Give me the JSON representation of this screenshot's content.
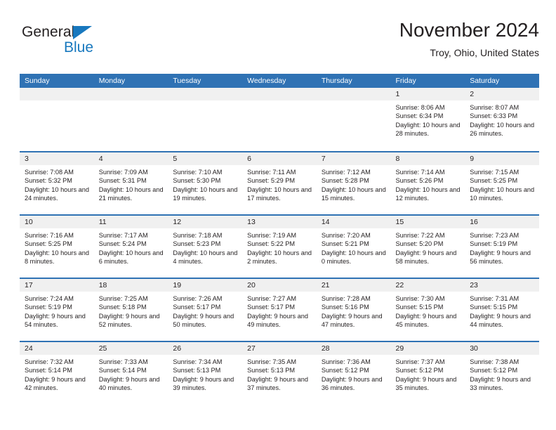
{
  "brand": {
    "name_part1": "General",
    "name_part2": "Blue"
  },
  "header": {
    "title": "November 2024",
    "subtitle": "Troy, Ohio, United States"
  },
  "colors": {
    "header_blue": "#2f72b4",
    "brand_blue": "#1878be",
    "daynum_band": "#f0f0f0",
    "text": "#231f20"
  },
  "calendar": {
    "weekday_headers": [
      "Sunday",
      "Monday",
      "Tuesday",
      "Wednesday",
      "Thursday",
      "Friday",
      "Saturday"
    ],
    "weeks": [
      [
        {
          "day": "",
          "sunrise": "",
          "sunset": "",
          "daylight": "",
          "empty": true
        },
        {
          "day": "",
          "sunrise": "",
          "sunset": "",
          "daylight": "",
          "empty": true
        },
        {
          "day": "",
          "sunrise": "",
          "sunset": "",
          "daylight": "",
          "empty": true
        },
        {
          "day": "",
          "sunrise": "",
          "sunset": "",
          "daylight": "",
          "empty": true
        },
        {
          "day": "",
          "sunrise": "",
          "sunset": "",
          "daylight": "",
          "empty": true
        },
        {
          "day": "1",
          "sunrise": "Sunrise: 8:06 AM",
          "sunset": "Sunset: 6:34 PM",
          "daylight": "Daylight: 10 hours and 28 minutes.",
          "empty": false
        },
        {
          "day": "2",
          "sunrise": "Sunrise: 8:07 AM",
          "sunset": "Sunset: 6:33 PM",
          "daylight": "Daylight: 10 hours and 26 minutes.",
          "empty": false
        }
      ],
      [
        {
          "day": "3",
          "sunrise": "Sunrise: 7:08 AM",
          "sunset": "Sunset: 5:32 PM",
          "daylight": "Daylight: 10 hours and 24 minutes.",
          "empty": false
        },
        {
          "day": "4",
          "sunrise": "Sunrise: 7:09 AM",
          "sunset": "Sunset: 5:31 PM",
          "daylight": "Daylight: 10 hours and 21 minutes.",
          "empty": false
        },
        {
          "day": "5",
          "sunrise": "Sunrise: 7:10 AM",
          "sunset": "Sunset: 5:30 PM",
          "daylight": "Daylight: 10 hours and 19 minutes.",
          "empty": false
        },
        {
          "day": "6",
          "sunrise": "Sunrise: 7:11 AM",
          "sunset": "Sunset: 5:29 PM",
          "daylight": "Daylight: 10 hours and 17 minutes.",
          "empty": false
        },
        {
          "day": "7",
          "sunrise": "Sunrise: 7:12 AM",
          "sunset": "Sunset: 5:28 PM",
          "daylight": "Daylight: 10 hours and 15 minutes.",
          "empty": false
        },
        {
          "day": "8",
          "sunrise": "Sunrise: 7:14 AM",
          "sunset": "Sunset: 5:26 PM",
          "daylight": "Daylight: 10 hours and 12 minutes.",
          "empty": false
        },
        {
          "day": "9",
          "sunrise": "Sunrise: 7:15 AM",
          "sunset": "Sunset: 5:25 PM",
          "daylight": "Daylight: 10 hours and 10 minutes.",
          "empty": false
        }
      ],
      [
        {
          "day": "10",
          "sunrise": "Sunrise: 7:16 AM",
          "sunset": "Sunset: 5:25 PM",
          "daylight": "Daylight: 10 hours and 8 minutes.",
          "empty": false
        },
        {
          "day": "11",
          "sunrise": "Sunrise: 7:17 AM",
          "sunset": "Sunset: 5:24 PM",
          "daylight": "Daylight: 10 hours and 6 minutes.",
          "empty": false
        },
        {
          "day": "12",
          "sunrise": "Sunrise: 7:18 AM",
          "sunset": "Sunset: 5:23 PM",
          "daylight": "Daylight: 10 hours and 4 minutes.",
          "empty": false
        },
        {
          "day": "13",
          "sunrise": "Sunrise: 7:19 AM",
          "sunset": "Sunset: 5:22 PM",
          "daylight": "Daylight: 10 hours and 2 minutes.",
          "empty": false
        },
        {
          "day": "14",
          "sunrise": "Sunrise: 7:20 AM",
          "sunset": "Sunset: 5:21 PM",
          "daylight": "Daylight: 10 hours and 0 minutes.",
          "empty": false
        },
        {
          "day": "15",
          "sunrise": "Sunrise: 7:22 AM",
          "sunset": "Sunset: 5:20 PM",
          "daylight": "Daylight: 9 hours and 58 minutes.",
          "empty": false
        },
        {
          "day": "16",
          "sunrise": "Sunrise: 7:23 AM",
          "sunset": "Sunset: 5:19 PM",
          "daylight": "Daylight: 9 hours and 56 minutes.",
          "empty": false
        }
      ],
      [
        {
          "day": "17",
          "sunrise": "Sunrise: 7:24 AM",
          "sunset": "Sunset: 5:19 PM",
          "daylight": "Daylight: 9 hours and 54 minutes.",
          "empty": false
        },
        {
          "day": "18",
          "sunrise": "Sunrise: 7:25 AM",
          "sunset": "Sunset: 5:18 PM",
          "daylight": "Daylight: 9 hours and 52 minutes.",
          "empty": false
        },
        {
          "day": "19",
          "sunrise": "Sunrise: 7:26 AM",
          "sunset": "Sunset: 5:17 PM",
          "daylight": "Daylight: 9 hours and 50 minutes.",
          "empty": false
        },
        {
          "day": "20",
          "sunrise": "Sunrise: 7:27 AM",
          "sunset": "Sunset: 5:17 PM",
          "daylight": "Daylight: 9 hours and 49 minutes.",
          "empty": false
        },
        {
          "day": "21",
          "sunrise": "Sunrise: 7:28 AM",
          "sunset": "Sunset: 5:16 PM",
          "daylight": "Daylight: 9 hours and 47 minutes.",
          "empty": false
        },
        {
          "day": "22",
          "sunrise": "Sunrise: 7:30 AM",
          "sunset": "Sunset: 5:15 PM",
          "daylight": "Daylight: 9 hours and 45 minutes.",
          "empty": false
        },
        {
          "day": "23",
          "sunrise": "Sunrise: 7:31 AM",
          "sunset": "Sunset: 5:15 PM",
          "daylight": "Daylight: 9 hours and 44 minutes.",
          "empty": false
        }
      ],
      [
        {
          "day": "24",
          "sunrise": "Sunrise: 7:32 AM",
          "sunset": "Sunset: 5:14 PM",
          "daylight": "Daylight: 9 hours and 42 minutes.",
          "empty": false
        },
        {
          "day": "25",
          "sunrise": "Sunrise: 7:33 AM",
          "sunset": "Sunset: 5:14 PM",
          "daylight": "Daylight: 9 hours and 40 minutes.",
          "empty": false
        },
        {
          "day": "26",
          "sunrise": "Sunrise: 7:34 AM",
          "sunset": "Sunset: 5:13 PM",
          "daylight": "Daylight: 9 hours and 39 minutes.",
          "empty": false
        },
        {
          "day": "27",
          "sunrise": "Sunrise: 7:35 AM",
          "sunset": "Sunset: 5:13 PM",
          "daylight": "Daylight: 9 hours and 37 minutes.",
          "empty": false
        },
        {
          "day": "28",
          "sunrise": "Sunrise: 7:36 AM",
          "sunset": "Sunset: 5:12 PM",
          "daylight": "Daylight: 9 hours and 36 minutes.",
          "empty": false
        },
        {
          "day": "29",
          "sunrise": "Sunrise: 7:37 AM",
          "sunset": "Sunset: 5:12 PM",
          "daylight": "Daylight: 9 hours and 35 minutes.",
          "empty": false
        },
        {
          "day": "30",
          "sunrise": "Sunrise: 7:38 AM",
          "sunset": "Sunset: 5:12 PM",
          "daylight": "Daylight: 9 hours and 33 minutes.",
          "empty": false
        }
      ]
    ]
  }
}
